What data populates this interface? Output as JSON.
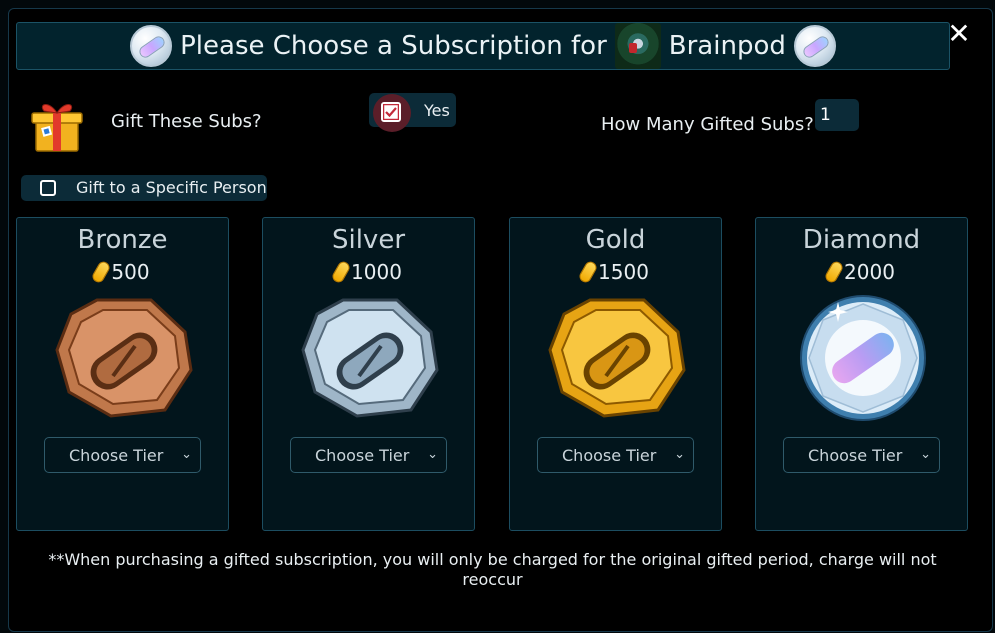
{
  "title": {
    "prefix": "Please Choose a Subscription for",
    "channel": "Brainpod"
  },
  "gift": {
    "label": "Gift These Subs?",
    "yes_label": "Yes",
    "yes_checked": true,
    "how_many_label": "How Many Gifted Subs?",
    "quantity": "1",
    "specific_label": "Gift to a Specific Person",
    "specific_checked": false
  },
  "tiers": [
    {
      "name": "Bronze",
      "price": "500",
      "select_label": "Choose Tier",
      "color": "#c07a4e"
    },
    {
      "name": "Silver",
      "price": "1000",
      "select_label": "Choose Tier",
      "color": "#b9cfe0"
    },
    {
      "name": "Gold",
      "price": "1500",
      "select_label": "Choose Tier",
      "color": "#f2b52a"
    },
    {
      "name": "Diamond",
      "price": "2000",
      "select_label": "Choose Tier",
      "color": "#dce9f6"
    }
  ],
  "footer_note": "**When purchasing a gifted subscription, you will only be charged for the original gifted period, charge will not reoccur",
  "icons": [
    "pill-coin-icon",
    "channel-avatar-icon",
    "close-icon",
    "gift-box-icon",
    "checkbox-icon",
    "bits-icon",
    "tier-coin-icon",
    "chevron-down-icon"
  ]
}
